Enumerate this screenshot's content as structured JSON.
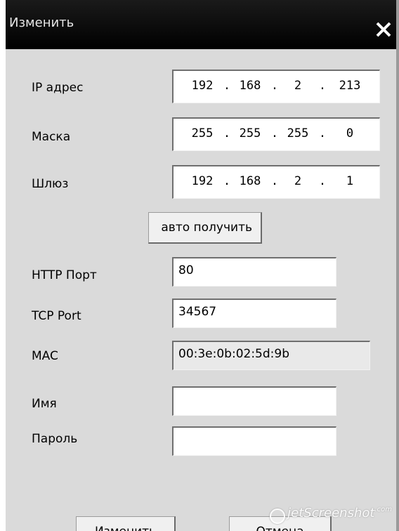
{
  "window": {
    "title": "Изменить",
    "close_icon": "close-icon"
  },
  "form": {
    "ip": {
      "label": "IP адрес",
      "octets": [
        "192",
        "168",
        "2",
        "213"
      ]
    },
    "mask": {
      "label": "Маска",
      "octets": [
        "255",
        "255",
        "255",
        "0"
      ]
    },
    "gateway": {
      "label": "Шлюз",
      "octets": [
        "192",
        "168",
        "2",
        "1"
      ]
    },
    "auto_button_label": "авто получить",
    "http_port": {
      "label": "HTTP Порт",
      "value": "80"
    },
    "tcp_port": {
      "label": "TCP Port",
      "value": "34567"
    },
    "mac": {
      "label": "MAC",
      "value": "00:3e:0b:02:5d:9b"
    },
    "username": {
      "label": "Имя",
      "value": ""
    },
    "password": {
      "label": "Пароль",
      "value": ""
    }
  },
  "buttons": {
    "ok_label": "Изменить",
    "cancel_label": "Отмена"
  },
  "watermark": {
    "text": "jetScreenshot",
    "suffix": ".com"
  },
  "dot": "."
}
